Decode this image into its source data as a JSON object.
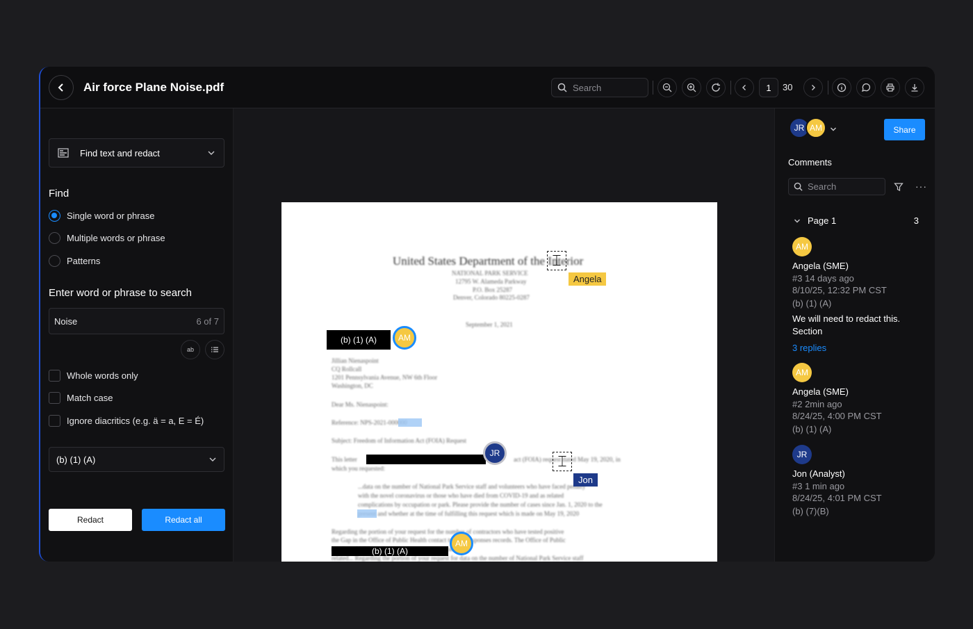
{
  "header": {
    "back_icon": "chevron-left-icon",
    "title": "Air force Plane Noise.pdf",
    "search_placeholder": "Search",
    "page_current": "1",
    "page_total": "30"
  },
  "left_panel": {
    "mode_label": "Find text and redact",
    "find_heading": "Find",
    "find_options": [
      {
        "label": "Single word or phrase",
        "selected": true
      },
      {
        "label": "Multiple words or phrase",
        "selected": false
      },
      {
        "label": "Patterns",
        "selected": false
      }
    ],
    "enter_label": "Enter word or phrase to search",
    "search_term": "Noise",
    "match_count": "6 of 7",
    "ab_label": "ab",
    "checkboxes": [
      {
        "label": "Whole words only",
        "checked": false
      },
      {
        "label": "Match case",
        "checked": false
      },
      {
        "label": "Ignore diacritics (e.g. ä = a, E = É)",
        "checked": false
      }
    ],
    "exemption_code": "(b) (1) (A)",
    "redact_label": "Redact",
    "redact_all_label": "Redact all"
  },
  "document": {
    "title": "United States Department of the Interior",
    "redaction_label_1": "(b) (1) (A)",
    "redaction_label_3": "(b) (1) (A)",
    "tag_angela": "Angela",
    "tag_jon": "Jon",
    "avatar_am": "AM",
    "avatar_jr": "JR"
  },
  "right_panel": {
    "collaborators": [
      "JR",
      "AM"
    ],
    "share_label": "Share",
    "comments_title": "Comments",
    "search_placeholder": "Search",
    "page_group_label": "Page 1",
    "page_group_count": "3",
    "comments": [
      {
        "initials": "AM",
        "name": "Angela (SME)",
        "meta1": "#3  14 days ago",
        "meta2": "8/10/25, 12:32 PM CST",
        "code": "(b) (1) (A)",
        "text": "We will need to redact this. Section",
        "link": "3 replies"
      },
      {
        "initials": "AM",
        "name": "Angela (SME)",
        "meta1": "#2  2min ago",
        "meta2": "8/24/25, 4:00 PM CST",
        "code": "(b) (1) (A)"
      },
      {
        "initials": "JR",
        "name": "Jon (Analyst)",
        "meta1": "#3  1 min ago",
        "meta2": "8/24/25, 4:01 PM CST",
        "code": "(b) (7)(B)"
      }
    ]
  },
  "colors": {
    "accent": "#1a8cff",
    "am_avatar": "#f5c842",
    "jr_avatar": "#1e3a8a"
  }
}
